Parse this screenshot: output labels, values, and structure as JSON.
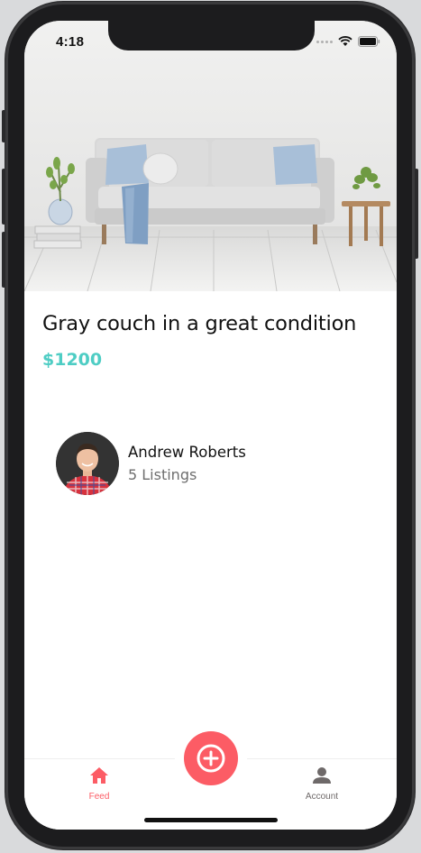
{
  "status_bar": {
    "time": "4:18"
  },
  "listing": {
    "title": "Gray couch in a great condition",
    "price": "$1200"
  },
  "seller": {
    "name": "Andrew Roberts",
    "listings": "5 Listings"
  },
  "tabbar": {
    "feed_label": "Feed",
    "account_label": "Account",
    "active_color": "#fc5c65",
    "inactive_color": "#6e6969"
  },
  "colors": {
    "accent": "#fc5c65",
    "price": "#4ecdc4"
  },
  "icons": {
    "feed": "home-icon",
    "add": "plus-circle-icon",
    "account": "account-icon"
  }
}
